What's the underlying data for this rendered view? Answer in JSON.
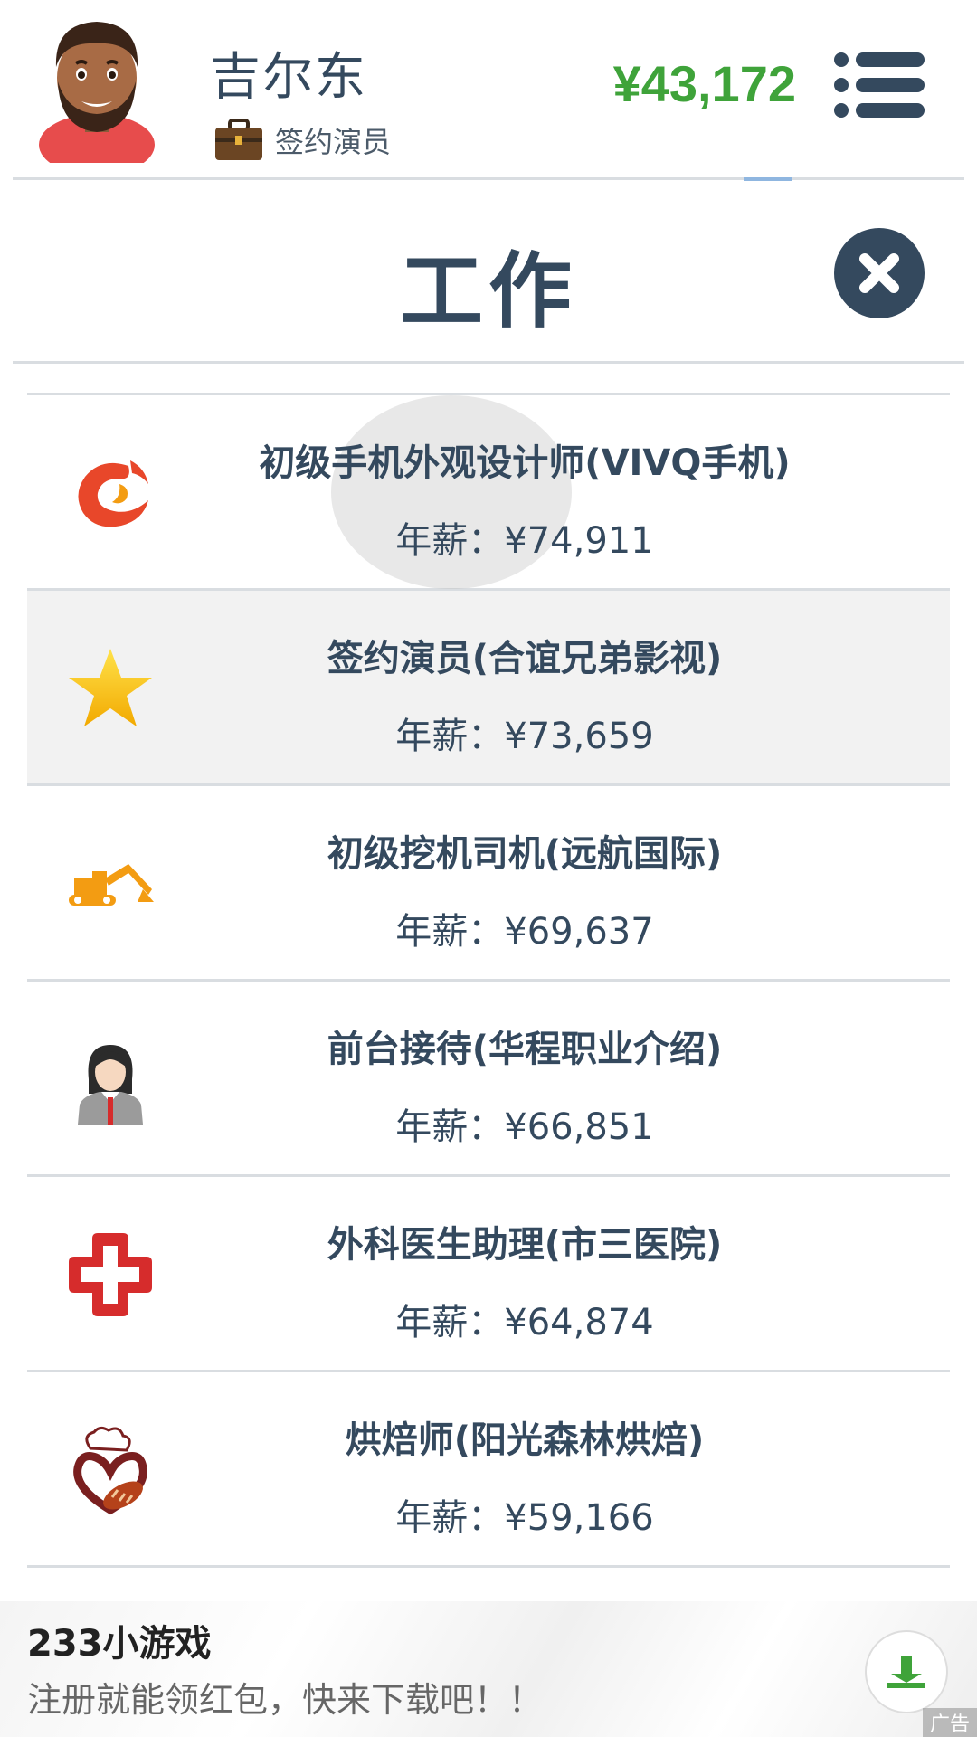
{
  "header": {
    "player_name": "吉尔东",
    "job_label": "签约演员",
    "money": "¥43,172"
  },
  "page": {
    "title": "工作"
  },
  "jobs": [
    {
      "title": "初级手机外观设计师(VIVQ手机)",
      "salary": "年薪：¥74,911",
      "icon": "phoenix-logo-icon"
    },
    {
      "title": "签约演员(合谊兄弟影视)",
      "salary": "年薪：¥73,659",
      "icon": "star-icon"
    },
    {
      "title": "初级挖机司机(远航国际)",
      "salary": "年薪：¥69,637",
      "icon": "excavator-icon"
    },
    {
      "title": "前台接待(华程职业介绍)",
      "salary": "年薪：¥66,851",
      "icon": "receptionist-icon"
    },
    {
      "title": "外科医生助理(市三医院)",
      "salary": "年薪：¥64,874",
      "icon": "medical-cross-icon"
    },
    {
      "title": "烘焙师(阳光森林烘焙)",
      "salary": "年薪：¥59,166",
      "icon": "baker-icon"
    }
  ],
  "ad": {
    "title": "233小游戏",
    "description": "注册就能领红包，快来下载吧！！",
    "tag": "广告"
  },
  "colors": {
    "money": "#3fa33a",
    "primary_text": "#34495e",
    "selected_row": "#f2f2f2"
  }
}
